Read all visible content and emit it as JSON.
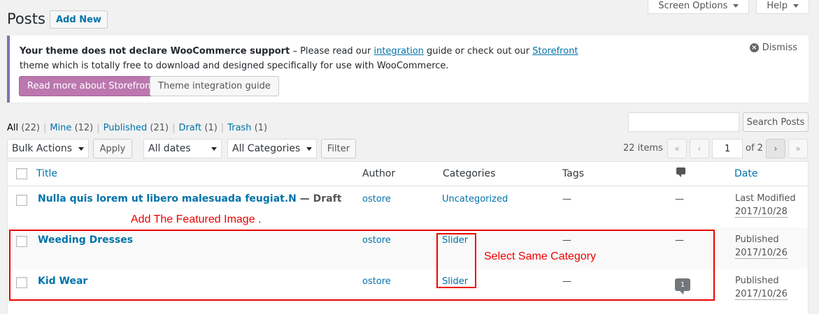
{
  "header": {
    "title": "Posts",
    "add_new": "Add New",
    "screen_options": "Screen Options",
    "help": "Help"
  },
  "notice": {
    "bold": "Your theme does not declare WooCommerce support",
    "text1": " – Please read our ",
    "link1": "integration",
    "text2": " guide or check out our ",
    "link2": "Storefront",
    "line2": "theme which is totally free to download and designed specifically for use with WooCommerce.",
    "btn_primary": "Read more about Storefront",
    "btn_secondary": "Theme integration guide",
    "dismiss": "Dismiss",
    "accent_color": "#826eb4"
  },
  "views": [
    {
      "label": "All",
      "count": "(22)"
    },
    {
      "label": "Mine",
      "count": "(12)"
    },
    {
      "label": "Published",
      "count": "(21)"
    },
    {
      "label": "Draft",
      "count": "(1)"
    },
    {
      "label": "Trash",
      "count": "(1)"
    }
  ],
  "search": {
    "button": "Search Posts",
    "value": ""
  },
  "filters": {
    "bulk": "Bulk Actions",
    "apply": "Apply",
    "dates": "All dates",
    "categories": "All Categories",
    "filter": "Filter"
  },
  "pagination": {
    "items": "22 items",
    "first": "«",
    "prev": "‹",
    "current": "1",
    "of": "of 2",
    "next": "›",
    "last": "»"
  },
  "table": {
    "columns": {
      "title": "Title",
      "author": "Author",
      "categories": "Categories",
      "tags": "Tags",
      "date": "Date"
    },
    "rows": [
      {
        "title": "Nulla quis lorem ut libero malesuada feugiat.N",
        "state": " — Draft",
        "author": "ostore",
        "category": "Uncategorized",
        "tags": "—",
        "comments": "—",
        "date_status": "Last Modified",
        "date": "2017/10/28"
      },
      {
        "title": "Weeding Dresses",
        "state": "",
        "author": "ostore",
        "category": "Slider",
        "tags": "—",
        "comments": "—",
        "date_status": "Published",
        "date": "2017/10/26"
      },
      {
        "title": "Kid Wear",
        "state": "",
        "author": "ostore",
        "category": "Slider",
        "tags": "—",
        "comments": "1",
        "date_status": "Published",
        "date": "2017/10/26"
      }
    ]
  },
  "annotations": {
    "featured": "Add The Featured Image .",
    "category": "Select Same Category",
    "color": "#e00000"
  }
}
